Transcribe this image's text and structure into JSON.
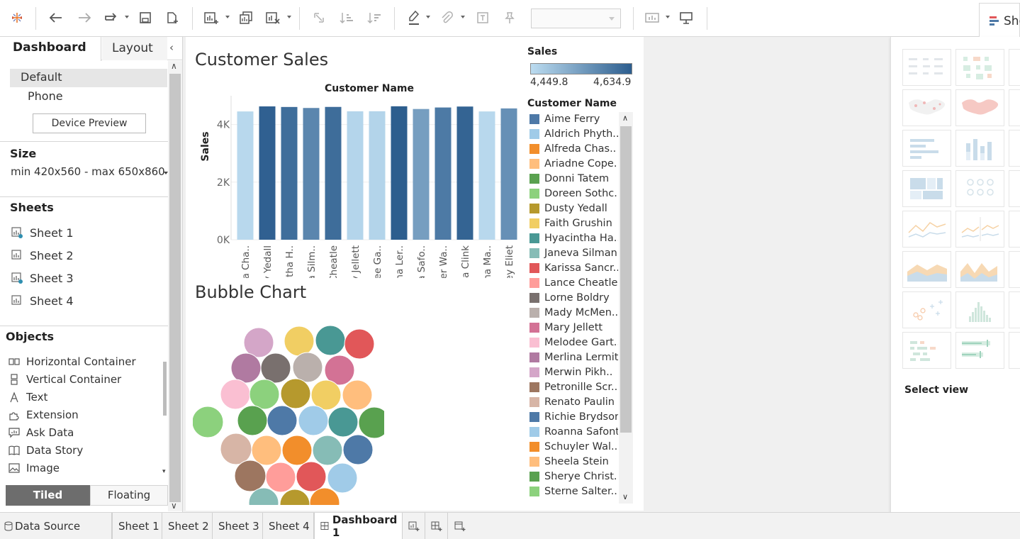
{
  "colors": {
    "accent_dark": "#2c5d8e",
    "accent_light": "#bcdcf0",
    "tiled_bg": "#6d6d6d"
  },
  "left_panel": {
    "tab_dashboard": "Dashboard",
    "tab_layout": "Layout",
    "device_default": "Default",
    "device_phone": "Phone",
    "device_preview": "Device Preview",
    "size_title": "Size",
    "size_value": "min 420x560 - max 650x860",
    "sheets_title": "Sheets",
    "sheets": [
      "Sheet 1",
      "Sheet 2",
      "Sheet 3",
      "Sheet 4"
    ],
    "objects_title": "Objects",
    "objects": [
      {
        "label": "Horizontal Container",
        "icon": "horizontal-container-icon"
      },
      {
        "label": "Vertical Container",
        "icon": "vertical-container-icon"
      },
      {
        "label": "Text",
        "icon": "text-icon"
      },
      {
        "label": "Extension",
        "icon": "extension-icon"
      },
      {
        "label": "Ask Data",
        "icon": "ask-data-icon"
      },
      {
        "label": "Data Story",
        "icon": "data-story-icon"
      },
      {
        "label": "Image",
        "icon": "image-icon"
      }
    ],
    "tiled": "Tiled",
    "floating": "Floating"
  },
  "dashboard": {
    "title_sales": "Customer Sales",
    "title_bubble": "Bubble Chart",
    "color_legend_title": "Sales",
    "color_legend_min": "4,449.8",
    "color_legend_max": "4,634.9",
    "customer_legend_title": "Customer Name",
    "customer_legend": [
      {
        "name": "Aime Ferry",
        "color": "#4e79a7"
      },
      {
        "name": "Aldrich Phyth..",
        "color": "#a0cbe8"
      },
      {
        "name": "Alfreda Chas..",
        "color": "#f28e2b"
      },
      {
        "name": "Ariadne Cope..",
        "color": "#ffbe7d"
      },
      {
        "name": "Donni Tatem",
        "color": "#59a14f"
      },
      {
        "name": "Doreen Sothc..",
        "color": "#8cd17d"
      },
      {
        "name": "Dusty Yedall",
        "color": "#b6992d"
      },
      {
        "name": "Faith Grushin",
        "color": "#f1ce63"
      },
      {
        "name": "Hyacintha Ha..",
        "color": "#499894"
      },
      {
        "name": "Janeva Silman",
        "color": "#86bcb6"
      },
      {
        "name": "Karissa Sancr..",
        "color": "#e15759"
      },
      {
        "name": "Lance Cheatle",
        "color": "#ff9d9a"
      },
      {
        "name": "Lorne Boldry",
        "color": "#79706e"
      },
      {
        "name": "Mady McMen..",
        "color": "#bab0ac"
      },
      {
        "name": "Mary Jellett",
        "color": "#d37295"
      },
      {
        "name": "Melodee Gart..",
        "color": "#fabfd2"
      },
      {
        "name": "Merlina Lermit",
        "color": "#b07aa1"
      },
      {
        "name": "Merwin Pikh..",
        "color": "#d4a6c8"
      },
      {
        "name": "Petronille Scr..",
        "color": "#9d7660"
      },
      {
        "name": "Renato Paulin",
        "color": "#d7b5a6"
      },
      {
        "name": "Richie Brydson",
        "color": "#4e79a7"
      },
      {
        "name": "Roanna Safont",
        "color": "#a0cbe8"
      },
      {
        "name": "Schuyler Wal..",
        "color": "#f28e2b"
      },
      {
        "name": "Sheela Stein",
        "color": "#ffbe7d"
      },
      {
        "name": "Sherye Christ..",
        "color": "#59a14f"
      },
      {
        "name": "Sterne Salter..",
        "color": "#8cd17d"
      }
    ]
  },
  "chart_data": [
    {
      "type": "bar",
      "title": "",
      "top_label": "Customer Name",
      "ylabel": "Sales",
      "yticks": [
        "0K",
        "2K",
        "4K"
      ],
      "ylim": [
        0,
        5000
      ],
      "categories": [
        "Alfreda Cha..",
        "Dusty Yedall",
        "Hyacintha H..",
        "Janeva Silm..",
        "Lance Cheatle",
        "Mary Jellett",
        "Melodee Ga..",
        "Merlina Ler..",
        "Roanna Safo..",
        "Schuyler Wa..",
        "Tamma Clink",
        "Wenona Ma..",
        "Yardley Eliet"
      ],
      "values": [
        4455,
        4630,
        4610,
        4575,
        4612,
        4460,
        4462,
        4634,
        4540,
        4592,
        4625,
        4455,
        4560
      ],
      "color_range": [
        4449.8,
        4634.9
      ]
    },
    {
      "type": "scatter",
      "subtype": "packed-bubble",
      "bubble_count": 30,
      "colors": [
        "#d4a6c8",
        "#f1ce63",
        "#499894",
        "#e15759",
        "#b07aa1",
        "#79706e",
        "#bab0ac",
        "#d37295",
        "#fabfd2",
        "#8cd17d",
        "#b6992d",
        "#f1ce63",
        "#ffbe7d",
        "#8cd17d",
        "#59a14f",
        "#4e79a7",
        "#a0cbe8",
        "#499894",
        "#59a14f",
        "#d7b5a6",
        "#ffbe7d",
        "#f28e2b",
        "#86bcb6",
        "#4e79a7",
        "#9d7660",
        "#ff9d9a",
        "#e15759",
        "#a0cbe8",
        "#86bcb6",
        "#b6992d",
        "#f28e2b"
      ]
    }
  ],
  "show_me": {
    "tab_label": "Show Me",
    "tab_visible": "Sho",
    "select_view": "Select view"
  },
  "bottom_tabs": {
    "data_source": "Data Source",
    "sheets": [
      "Sheet 1",
      "Sheet 2",
      "Sheet 3",
      "Sheet 4"
    ],
    "dashboard": "Dashboard 1"
  }
}
